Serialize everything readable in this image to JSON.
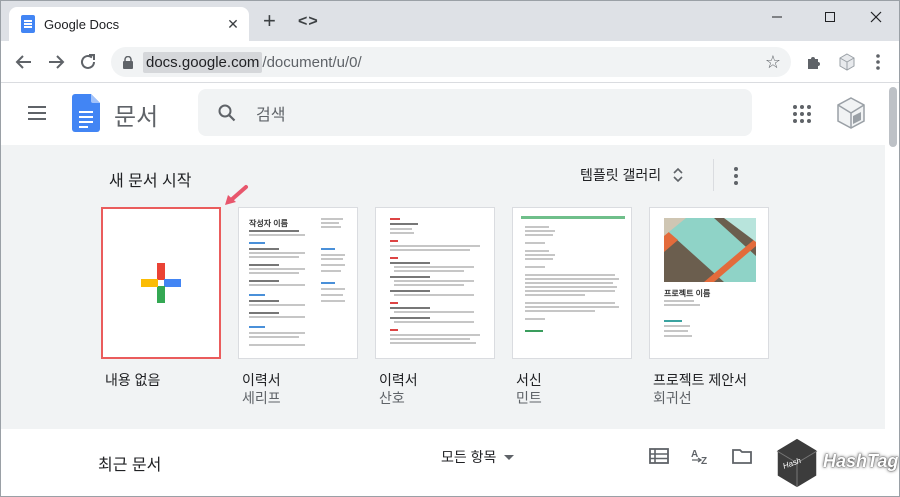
{
  "browser": {
    "tab_title": "Google Docs",
    "new_tab": "+",
    "code_icon": "<>",
    "url_host": "docs.google.com",
    "url_path": "/document/u/0/"
  },
  "app": {
    "title": "문서",
    "search_placeholder": "검색"
  },
  "templates": {
    "heading": "새 문서 시작",
    "gallery_label": "템플릿 갤러리",
    "cards": [
      {
        "label": "내용 없음",
        "sub": ""
      },
      {
        "label": "이력서",
        "sub": "세리프"
      },
      {
        "label": "이력서",
        "sub": "산호"
      },
      {
        "label": "서신",
        "sub": "민트"
      },
      {
        "label": "프로젝트 제안서",
        "sub": "회귀선"
      }
    ],
    "preview": {
      "serif_name": "작성자 이름",
      "project_name": "프로젝트 이름"
    }
  },
  "recent": {
    "title": "최근 문서",
    "owner_filter": "모든 항목"
  },
  "watermark": {
    "text": "HashTag"
  },
  "colors": {
    "accent_blue": "#4285f4",
    "blank_border": "#ea5c5c"
  }
}
